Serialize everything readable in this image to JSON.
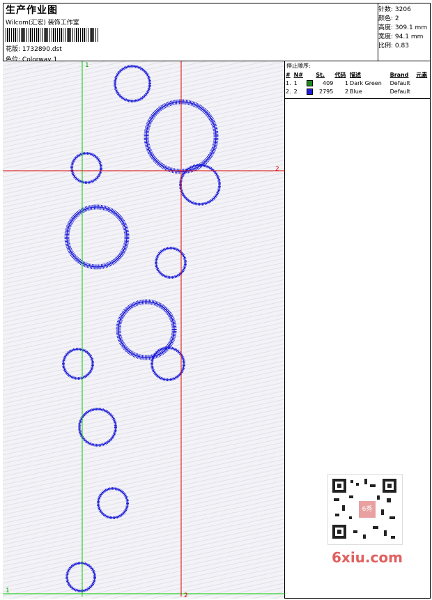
{
  "header": {
    "title": "生产作业图",
    "company": "Wilcom(汇宏) 装饰工作室",
    "design_label": "花版:",
    "design_file": "1732890.dst",
    "colorway_label": "色位:",
    "colorway": "Colorway 1"
  },
  "info": [
    {
      "label": "针数:",
      "value": "3206"
    },
    {
      "label": "颜色:",
      "value": "2"
    },
    {
      "label": "高度:",
      "value": "309.1 mm"
    },
    {
      "label": "宽度:",
      "value": "94.1 mm"
    },
    {
      "label": "比例:",
      "value": "0.83"
    }
  ],
  "stop_sequence": {
    "title": "停止顺序:",
    "columns": [
      "#",
      "N#",
      "St.",
      "代码",
      "描述",
      "Brand",
      "元素"
    ],
    "rows": [
      {
        "num": "1.",
        "n": "1",
        "color": "#1a8a1a",
        "st": "409",
        "code": "1",
        "desc": "Dark Green",
        "brand": "Default"
      },
      {
        "num": "2.",
        "n": "2",
        "color": "#1b1bd8",
        "st": "2795",
        "code": "2",
        "desc": "Blue",
        "brand": "Default"
      }
    ]
  },
  "guides": {
    "vertical_green_label": "1",
    "horizontal_red_label": "2",
    "bottom_green_label": "1",
    "bottom_red_label": "2"
  },
  "colors": {
    "stitch": "#1b1bd8",
    "guide_green": "#00cc00",
    "guide_red": "#dd0000"
  },
  "watermark": "6xiu.com",
  "qr_badge": "6秀"
}
